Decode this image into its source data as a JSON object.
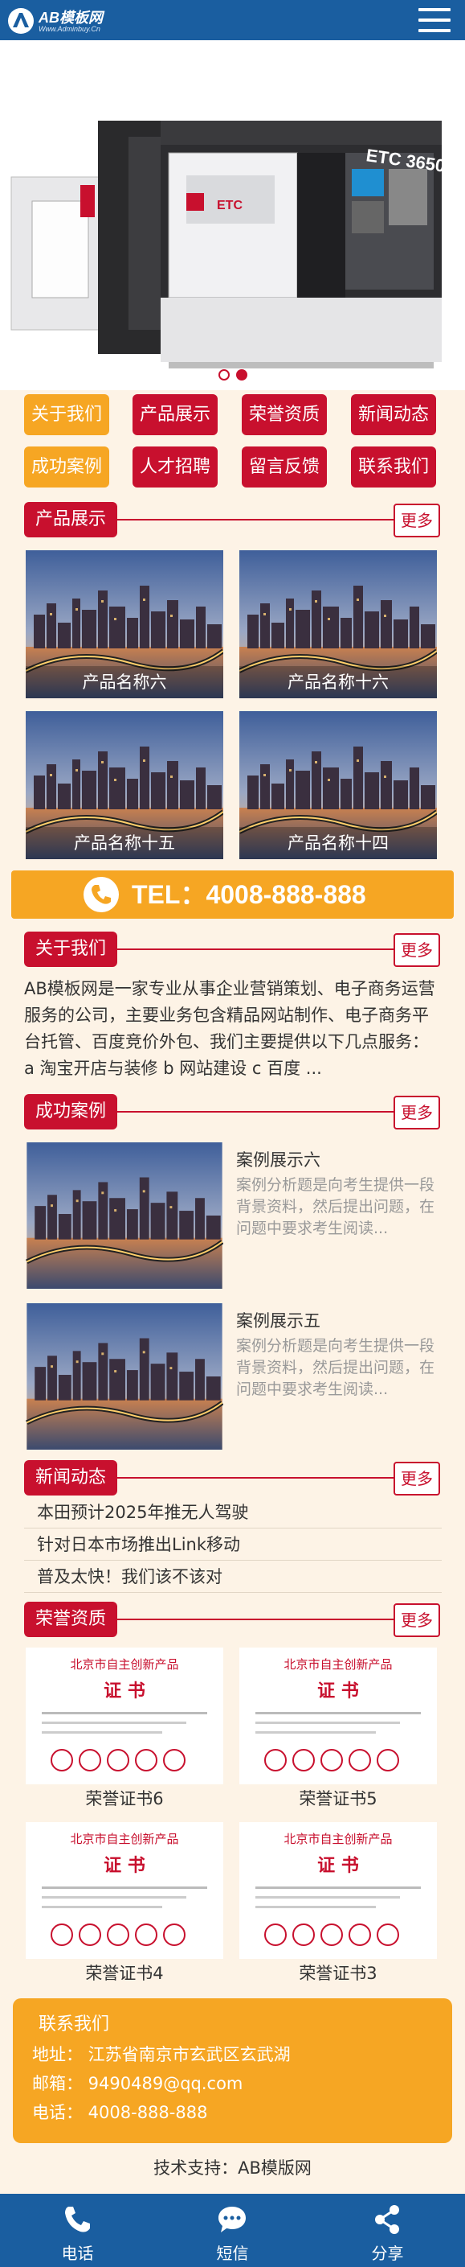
{
  "header": {
    "logo_text": "AB模板网",
    "logo_sub": "Www.Adminbuy.Cn",
    "menu_icon": "hamburger-menu-icon"
  },
  "banner": {
    "slides": 2,
    "active": 2
  },
  "nav": [
    "关于我们",
    "产品展示",
    "荣誉资质",
    "新闻动态",
    "成功案例",
    "人才招聘",
    "留言反馈",
    "联系我们"
  ],
  "products": {
    "title": "产品展示",
    "more": "更多",
    "items": [
      "产品名称六",
      "产品名称十六",
      "产品名称十五",
      "产品名称十四"
    ]
  },
  "tel": {
    "text": "TEL：4008-888-888",
    "icon": "phone-icon"
  },
  "about": {
    "title": "关于我们",
    "more": "更多",
    "text": "AB模板网是一家专业从事企业营销策划、电子商务运营服务的公司，主要业务包含精品网站制作、电子商务平台托管、百度竞价外包、我们主要提供以下几点服务： a 淘宝开店与装修 b 网站建设 c 百度 ..."
  },
  "cases": {
    "title": "成功案例",
    "more": "更多",
    "items": [
      {
        "title": "案例展示六",
        "desc": "案例分析题是向考生提供一段背景资料，然后提出问题，在问题中要求考生阅读..."
      },
      {
        "title": "案例展示五",
        "desc": "案例分析题是向考生提供一段背景资料，然后提出问题，在问题中要求考生阅读..."
      }
    ]
  },
  "news": {
    "title": "新闻动态",
    "more": "更多",
    "items": [
      "本田预计2025年推无人驾驶",
      "针对日本市场推出Link移动",
      "普及太快！我们该不该对"
    ]
  },
  "honors": {
    "title": "荣誉资质",
    "more": "更多",
    "cert_heading": "北京市自主创新产品",
    "cert_title": "证  书",
    "items": [
      "荣誉证书6",
      "荣誉证书5",
      "荣誉证书4",
      "荣誉证书3"
    ]
  },
  "contact": {
    "title": "联系我们",
    "address": "地址：  江苏省南京市玄武区玄武湖",
    "email": "邮箱：  9490489@qq.com",
    "phone": "电话：  4008-888-888"
  },
  "support": "技术支持：AB模版网",
  "footer": [
    {
      "label": "电话",
      "icon": "phone-icon"
    },
    {
      "label": "短信",
      "icon": "message-icon"
    },
    {
      "label": "分享",
      "icon": "share-icon"
    }
  ],
  "colors": {
    "blue": "#1a5ea0",
    "red": "#c8102e",
    "orange": "#f6a623",
    "bg": "#fdf3e6"
  }
}
